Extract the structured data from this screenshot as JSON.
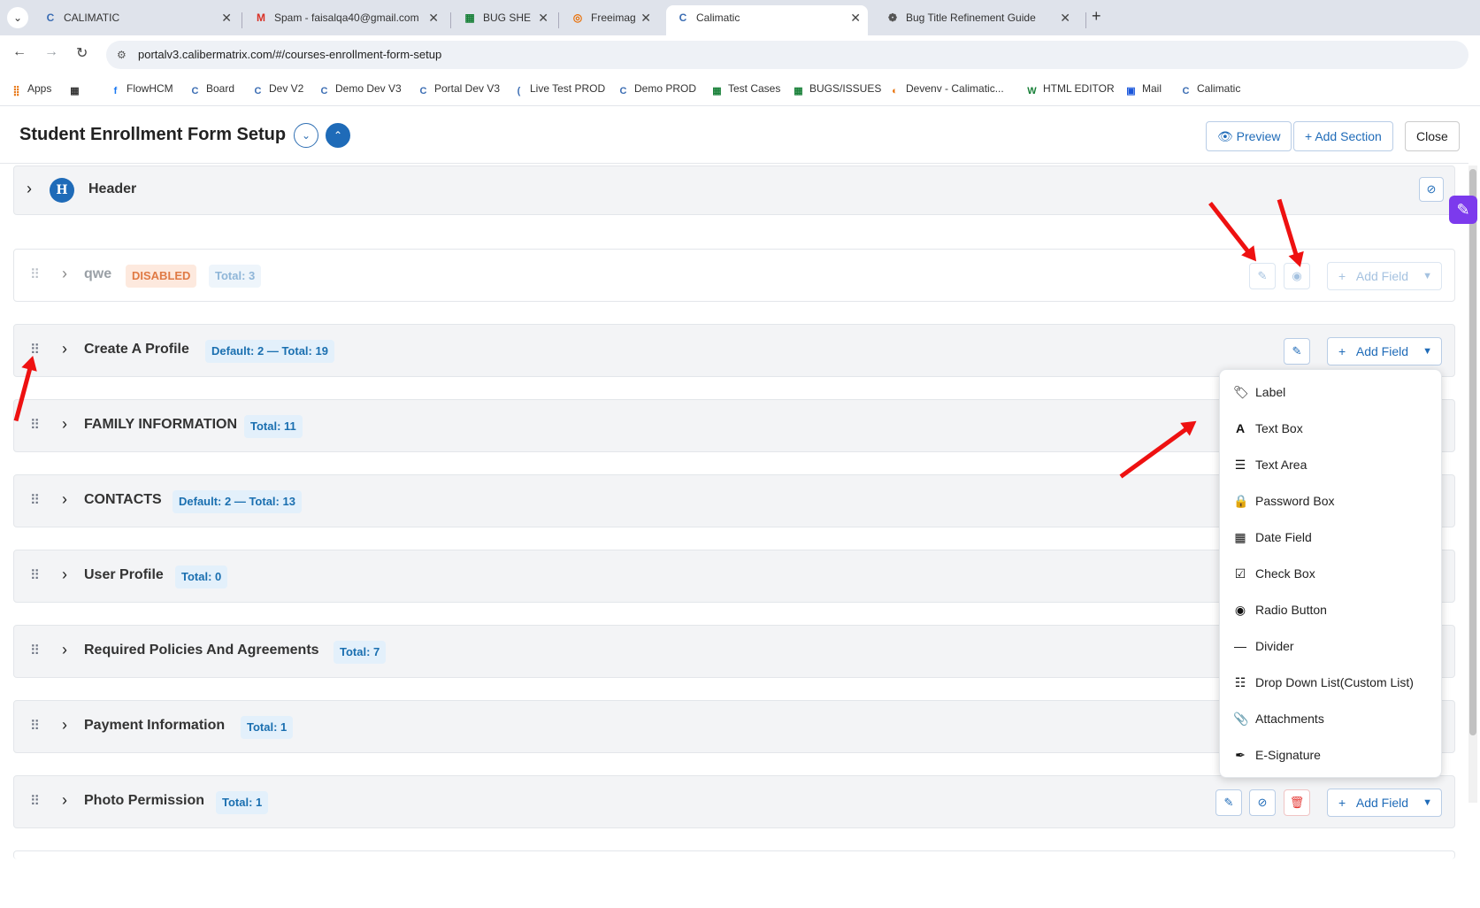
{
  "browser": {
    "tabs": [
      {
        "title": "CALIMATIC",
        "active": false
      },
      {
        "title": "Spam - faisalqa40@gmail.com",
        "active": false
      },
      {
        "title": "BUG SHE",
        "active": false
      },
      {
        "title": "Freeimag",
        "active": false
      },
      {
        "title": "Calimatic",
        "active": true
      },
      {
        "title": "Bug Title Refinement Guide",
        "active": false
      }
    ],
    "url": "portalv3.calibermatrix.com/#/courses-enrollment-form-setup",
    "bookmarks": [
      "Apps",
      "FlowHCM",
      "Board",
      "Dev V2",
      "Demo Dev V3",
      "Portal Dev V3",
      "Live Test PROD",
      "Demo PROD",
      "Test Cases",
      "BUGS/ISSUES",
      "Devenv - Calimatic...",
      "HTML EDITOR",
      "Mail",
      "Calimatic"
    ]
  },
  "page": {
    "title": "Student Enrollment Form Setup",
    "preview_label": "Preview",
    "add_section_label": "Add Section",
    "close_label": "Close"
  },
  "header_section": {
    "avatar_letter": "H",
    "title": "Header"
  },
  "sections": [
    {
      "title": "qwe",
      "status": "DISABLED",
      "badge": "Total: 3"
    },
    {
      "title": "Create A Profile",
      "badge": "Default: 2 — Total: 19"
    },
    {
      "title": "FAMILY INFORMATION",
      "badge": "Total: 11"
    },
    {
      "title": "CONTACTS",
      "badge": "Default: 2 — Total: 13"
    },
    {
      "title": "User Profile",
      "badge": "Total: 0"
    },
    {
      "title": "Required Policies And Agreements",
      "badge": "Total: 7"
    },
    {
      "title": "Payment Information",
      "badge": "Total: 1"
    },
    {
      "title": "Photo Permission",
      "badge": "Total: 1"
    }
  ],
  "add_field_label": "Add Field",
  "field_menu": [
    {
      "label": "Label",
      "icon": "tag-icon"
    },
    {
      "label": "Text Box",
      "icon": "letter-a-icon"
    },
    {
      "label": "Text Area",
      "icon": "align-left-icon"
    },
    {
      "label": "Password Box",
      "icon": "lock-icon"
    },
    {
      "label": "Date Field",
      "icon": "calendar-icon"
    },
    {
      "label": "Check Box",
      "icon": "checkbox-icon"
    },
    {
      "label": "Radio Button",
      "icon": "radio-icon"
    },
    {
      "label": "Divider",
      "icon": "minus-icon"
    },
    {
      "label": "Drop Down List(Custom List)",
      "icon": "list-icon"
    },
    {
      "label": "Attachments",
      "icon": "paperclip-icon"
    },
    {
      "label": "E-Signature",
      "icon": "brush-icon"
    }
  ],
  "colors": {
    "primary": "#1f6bb8",
    "disabled_badge": "#e07a45",
    "danger": "#e53935",
    "annotation_arrow": "#ee1111"
  }
}
